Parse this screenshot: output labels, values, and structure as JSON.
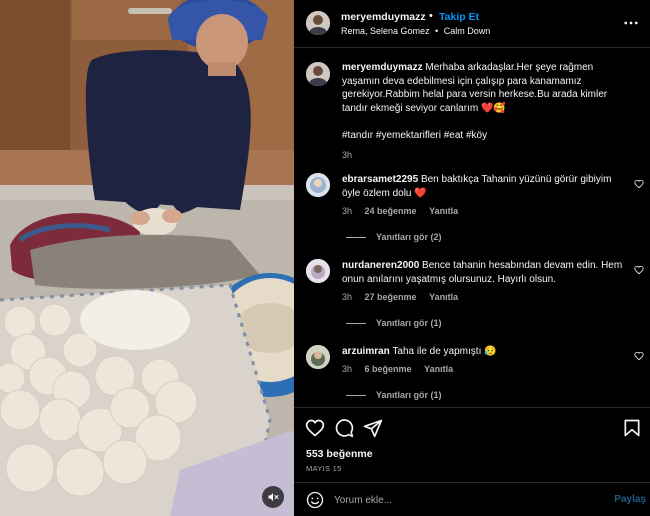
{
  "colors": {
    "background": "#000000",
    "text": "#f5f5f5",
    "secondary_text": "#a8a8a8",
    "link_blue": "#0095f6",
    "divider": "#262626",
    "like_red": "#ff3040"
  },
  "header": {
    "username": "meryemduymazz",
    "dot": "•",
    "follow_label": "Takip Et",
    "audio_artist": "Rema, Selena Gomez",
    "audio_dot": "•",
    "audio_track": "Calm Down",
    "more_icon": "more-horizontal-icon"
  },
  "caption": {
    "username": "meryemduymazz",
    "text": "Merhaba arkadaşlar.Her şeye rağmen yaşamın deva edebilmesi için çalışıp para kanamamız gerekiyor.Rabbim helal para versin herkese.Bu arada kimler tandır ekmeği seviyor canlarım ❤️🥰",
    "hashtags": "#tandır #yemektarifleri #eat #köy",
    "time": "3h"
  },
  "comments": [
    {
      "username": "ebrarsamet2295",
      "text": "Ben baktıkça Tahanin yüzünü görür gibiyim öyle özlem dolu ❤️",
      "time": "3h",
      "likes": "24 beğenme",
      "reply_label": "Yanıtla",
      "replies_label": "Yanıtları gör (2)"
    },
    {
      "username": "nurdaneren2000",
      "text": "Bence tahanin hesabından devam edin. Hem onun anılarını yaşatmış olursunuz. Hayırlı olsun.",
      "time": "3h",
      "likes": "27 beğenme",
      "reply_label": "Yanıtla",
      "replies_label": "Yanıtları gör (1)"
    },
    {
      "username": "arzuimran",
      "text": "Taha ile de yapmıştı 😥",
      "time": "3h",
      "likes": "6 beğenme",
      "reply_label": "Yanıtla",
      "replies_label": "Yanıtları gör (1)"
    }
  ],
  "actions": {
    "like_icon": "heart-icon",
    "comment_icon": "comment-icon",
    "share_icon": "share-icon",
    "save_icon": "bookmark-icon",
    "likes_count": "553 beğenme",
    "date": "MAYIS 15"
  },
  "add_comment": {
    "emoji_icon": "emoji-icon",
    "placeholder": "Yorum ekle...",
    "post_label": "Paylaş"
  },
  "media": {
    "mute_icon": "speaker-muted-icon"
  }
}
